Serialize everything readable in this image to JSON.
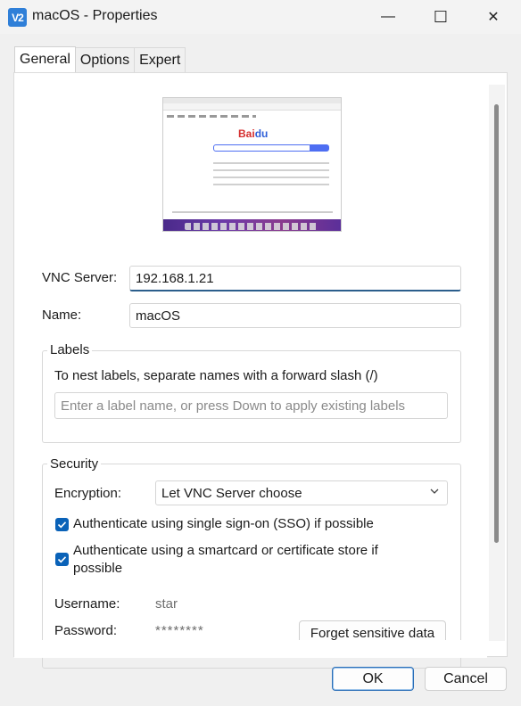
{
  "window": {
    "icon_text": "V2",
    "title": "macOS - Properties",
    "minimize_glyph": "—",
    "maximize_glyph": "☐",
    "close_glyph": "✕"
  },
  "tabs": [
    {
      "label": "General",
      "active": true
    },
    {
      "label": "Options",
      "active": false
    },
    {
      "label": "Expert",
      "active": false
    }
  ],
  "preview": {
    "logo_red": "Bai",
    "logo_blue": "du"
  },
  "form": {
    "vnc_server_label": "VNC Server:",
    "vnc_server_value": "192.168.1.21",
    "name_label": "Name:",
    "name_value": "macOS"
  },
  "labels_group": {
    "title": "Labels",
    "hint": "To nest labels, separate names with a forward slash (/)",
    "placeholder": "Enter a label name, or press Down to apply existing labels"
  },
  "security_group": {
    "title": "Security",
    "encryption_label": "Encryption:",
    "encryption_value": "Let VNC Server choose",
    "sso_label": "Authenticate using single sign-on (SSO) if possible",
    "sso_checked": true,
    "smartcard_label_line1": "Authenticate using a smartcard or certificate store if",
    "smartcard_label_line2": "possible",
    "smartcard_checked": true,
    "username_label": "Username:",
    "username_value": "star",
    "password_label": "Password:",
    "password_value": "********",
    "forget_button": "Forget sensitive data"
  },
  "footer": {
    "ok_label": "OK",
    "cancel_label": "Cancel"
  },
  "colors": {
    "accent": "#0a62b8",
    "focus_underline": "#2b5e8c"
  }
}
